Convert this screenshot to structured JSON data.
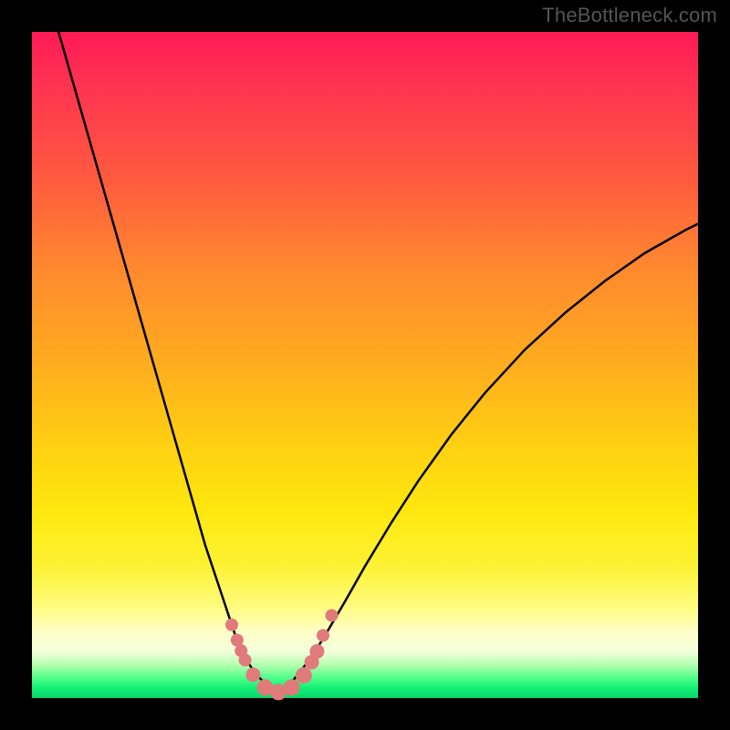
{
  "watermark": "TheBottleneck.com",
  "chart_data": {
    "type": "line",
    "title": "",
    "xlabel": "",
    "ylabel": "",
    "xlim": [
      0,
      100
    ],
    "ylim": [
      0,
      100
    ],
    "series": [
      {
        "name": "left-curve",
        "x": [
          4,
          6,
          8,
          10,
          12,
          14,
          16,
          18,
          20,
          22,
          24,
          26,
          28,
          30,
          31,
          32,
          33,
          34,
          35,
          36,
          37
        ],
        "y": [
          100,
          93,
          86,
          79,
          72,
          65,
          58,
          51,
          44,
          37,
          30,
          23,
          17,
          11,
          8,
          6,
          4.5,
          3.2,
          2.2,
          1.4,
          0.8
        ]
      },
      {
        "name": "right-curve",
        "x": [
          37,
          38,
          39,
          40,
          42,
          44,
          47,
          50,
          54,
          58,
          63,
          68,
          74,
          80,
          86,
          92,
          98,
          100
        ],
        "y": [
          0.8,
          1.4,
          2.4,
          3.6,
          6.2,
          9.4,
          14.5,
          19.8,
          26.4,
          32.6,
          39.6,
          45.8,
          52.3,
          57.8,
          62.6,
          66.8,
          70.2,
          71.2
        ]
      }
    ],
    "markers": {
      "name": "highlighted-points",
      "color": "#e17a7a",
      "points": [
        {
          "x": 30.0,
          "y": 11.0,
          "r": 7
        },
        {
          "x": 30.8,
          "y": 8.7,
          "r": 7
        },
        {
          "x": 31.4,
          "y": 7.1,
          "r": 7
        },
        {
          "x": 32.0,
          "y": 5.7,
          "r": 7
        },
        {
          "x": 33.2,
          "y": 3.5,
          "r": 8
        },
        {
          "x": 35.0,
          "y": 1.6,
          "r": 9
        },
        {
          "x": 37.0,
          "y": 0.9,
          "r": 9
        },
        {
          "x": 39.0,
          "y": 1.6,
          "r": 9
        },
        {
          "x": 40.8,
          "y": 3.4,
          "r": 9
        },
        {
          "x": 42.0,
          "y": 5.4,
          "r": 8
        },
        {
          "x": 42.8,
          "y": 7.0,
          "r": 8
        },
        {
          "x": 43.7,
          "y": 9.4,
          "r": 7
        },
        {
          "x": 45.0,
          "y": 12.4,
          "r": 7
        }
      ]
    },
    "background_gradient": {
      "top": "#ff1a57",
      "upper_mid": "#ff8a2e",
      "mid": "#ffd012",
      "lower_mid": "#fdf232",
      "band": "#4fff88",
      "bottom": "#0cd26c"
    }
  }
}
